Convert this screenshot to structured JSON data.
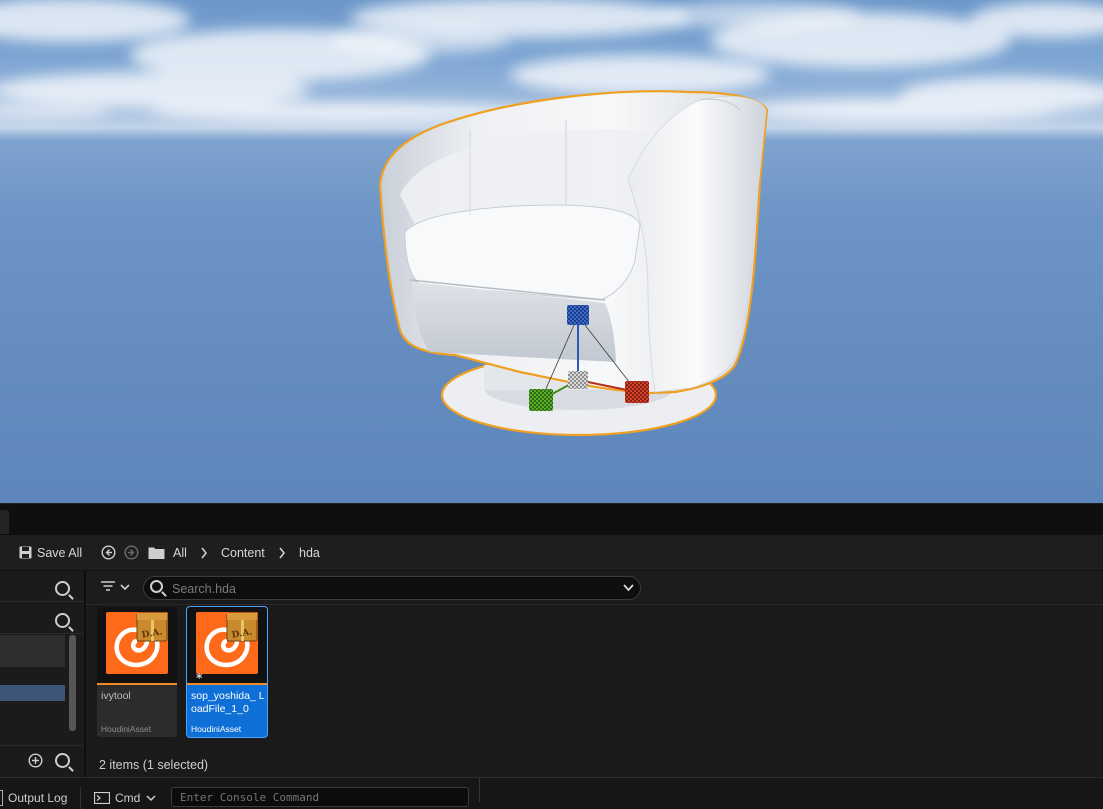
{
  "toolbar": {
    "save_all_label": "Save All",
    "breadcrumb": [
      "All",
      "Content",
      "hda"
    ]
  },
  "search": {
    "placeholder": "Search.hda"
  },
  "assets": [
    {
      "name": "ivytool",
      "type": "HoudiniAsset",
      "selected": false
    },
    {
      "name": "sop_yoshida_ LoadFile_1_0",
      "type": "HoudiniAsset",
      "selected": true
    }
  ],
  "status": {
    "items_text": "2 items (1 selected)"
  },
  "bottom": {
    "output_log_label": "Output Log",
    "cmd_label": "Cmd",
    "console_placeholder": "Enter Console Command"
  },
  "colors": {
    "selection_outline": "#f5a623",
    "selected_tile": "#0e6fd6",
    "houdini_orange": "#ff6a1a"
  },
  "icons": [
    "save-icon",
    "back-icon",
    "forward-icon",
    "folder-icon",
    "chevron-right-icon",
    "filter-icon",
    "search-icon",
    "chevron-down-icon",
    "add-icon",
    "console-icon"
  ]
}
